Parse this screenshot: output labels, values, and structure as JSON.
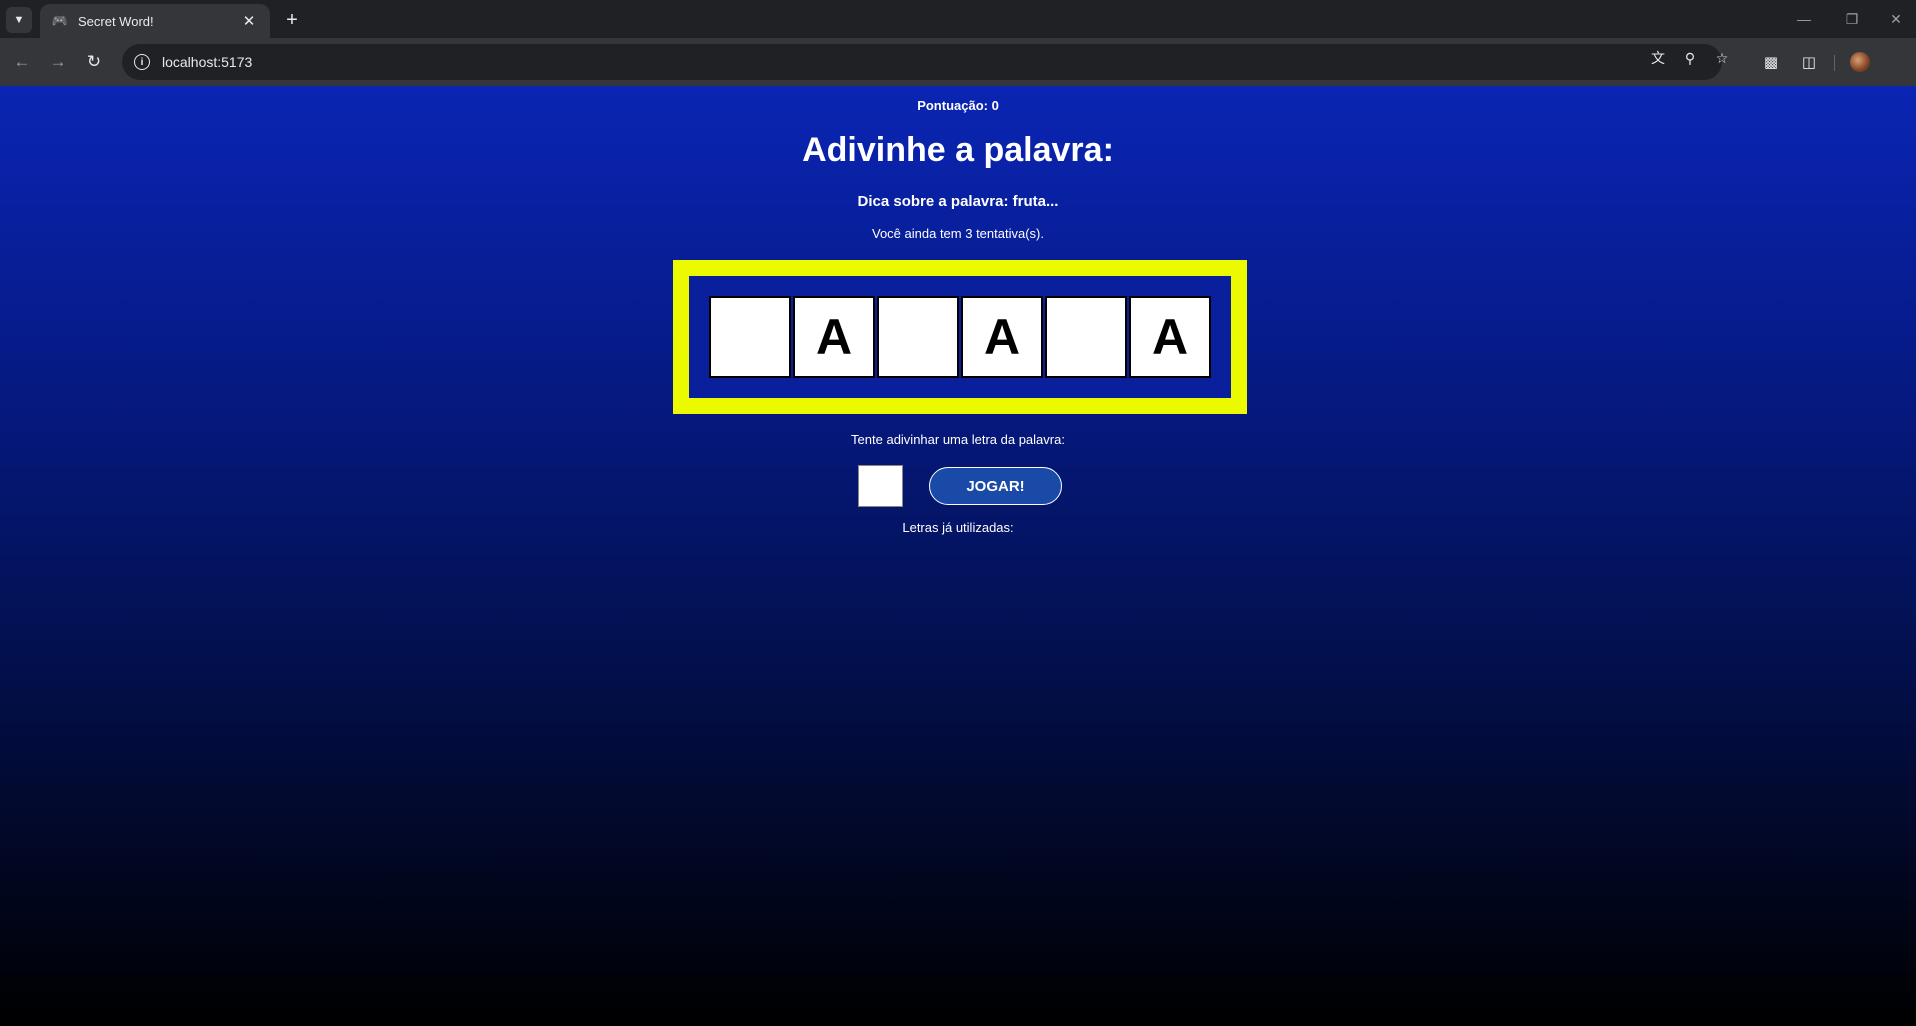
{
  "browser": {
    "tab_title": "Secret Word!",
    "url": "localhost:5173",
    "icons": [
      "tab-list-icon",
      "gamepad-icon",
      "close-icon",
      "plus-icon",
      "back-icon",
      "forward-icon",
      "reload-icon",
      "info-icon",
      "translate-icon",
      "zoom-icon",
      "star-icon",
      "extension-icon",
      "puzzle-icon",
      "minimize-icon",
      "restore-icon",
      "close-window-icon"
    ]
  },
  "game": {
    "score_label": "Pontuação: 0",
    "heading": "Adivinhe a palavra:",
    "tip": "Dica sobre a palavra: fruta...",
    "attempts": "Você ainda tem 3 tentativa(s).",
    "letters": [
      "",
      "A",
      "",
      "A",
      "",
      "A"
    ],
    "guess_prompt": "Tente adivinhar uma letra da palavra:",
    "guess_value": "",
    "play_button": "JOGAR!",
    "used_letters_label": "Letras já utilizadas:"
  },
  "colors": {
    "frame": "#ecfa00",
    "background_top": "#0a25b4",
    "background_bottom": "#000000",
    "button": "#1a4aa8"
  }
}
